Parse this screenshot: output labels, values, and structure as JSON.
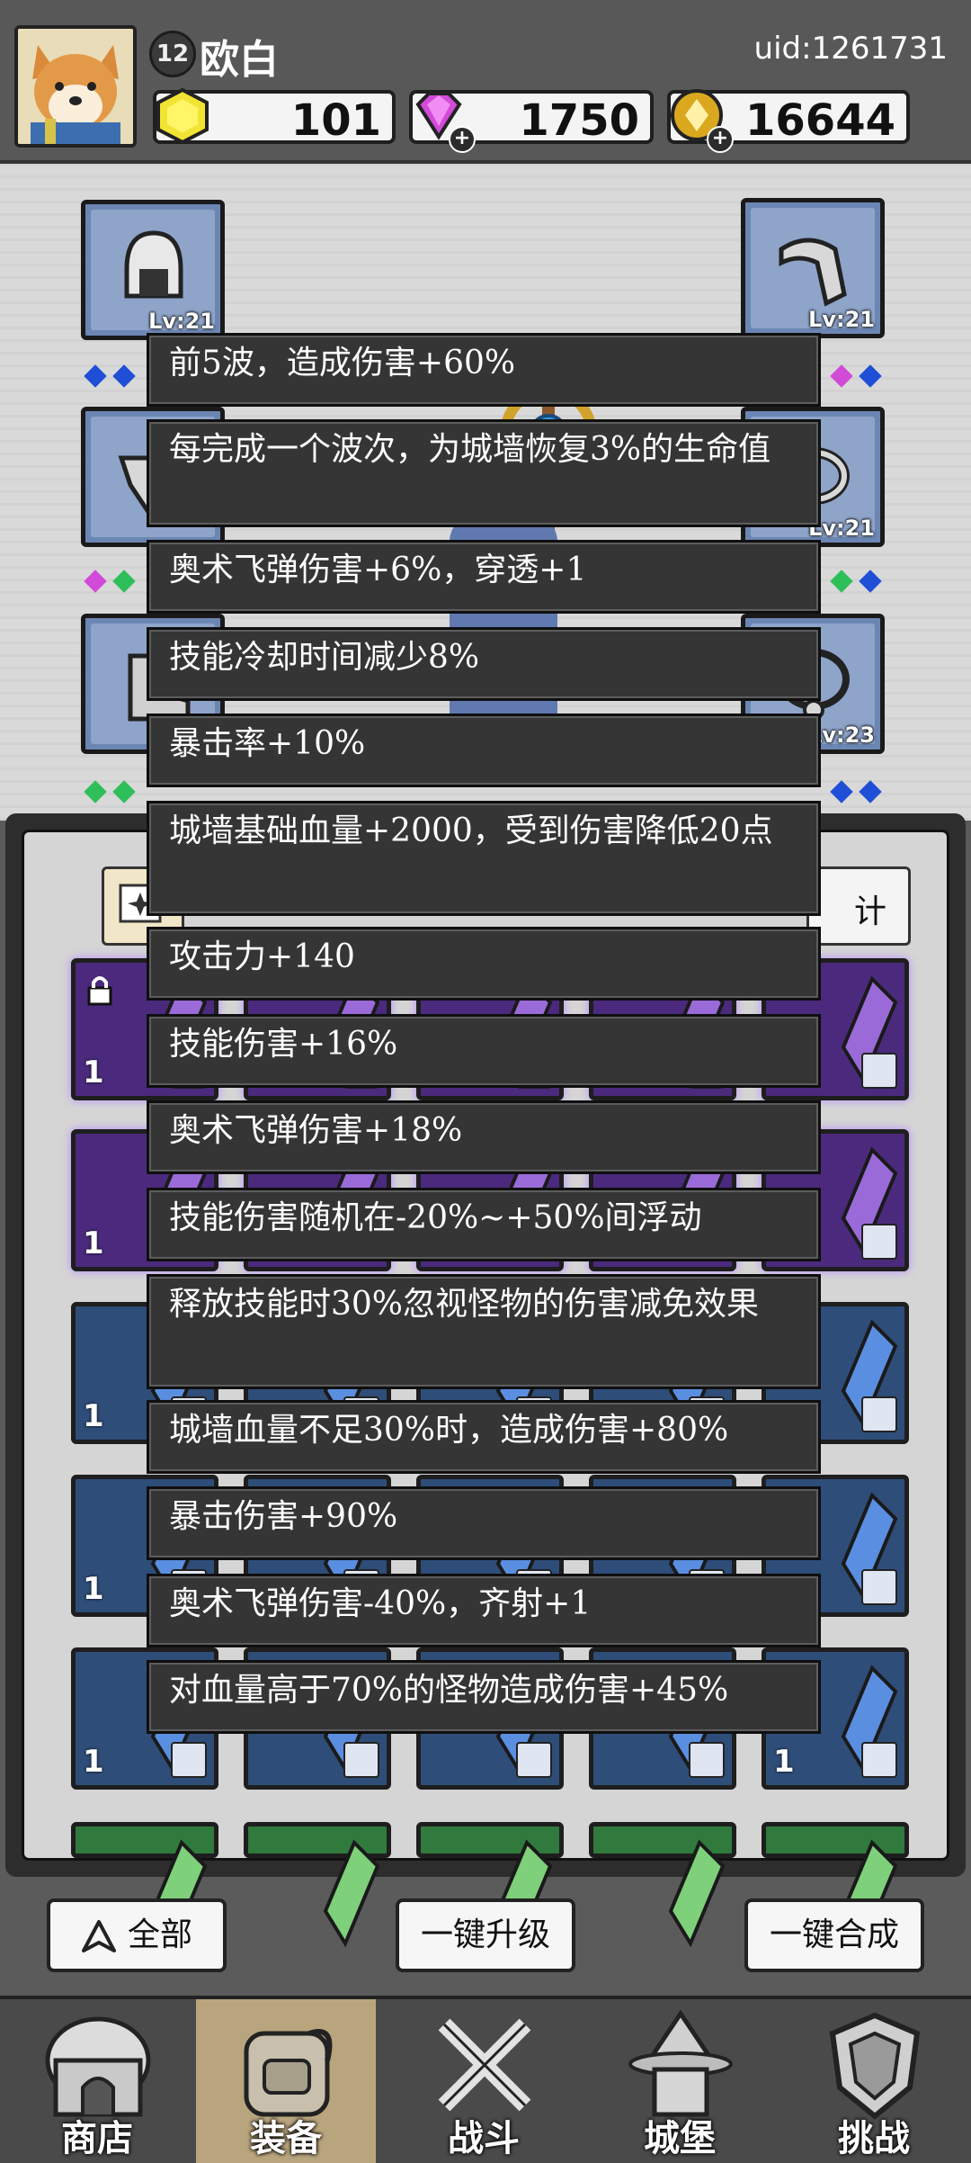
{
  "player": {
    "level": "12",
    "name": "欧白",
    "uid": "uid:1261731"
  },
  "currency": {
    "gold": "101",
    "gems": "1750",
    "coins": "16644"
  },
  "equipment": {
    "slots": [
      {
        "side": "left",
        "level": "Lv:21",
        "icon": "helmet-icon"
      },
      {
        "side": "left",
        "level": "",
        "icon": "scarf-icon"
      },
      {
        "side": "left",
        "level": "",
        "icon": "boots-icon"
      },
      {
        "side": "right",
        "level": "Lv:21",
        "icon": "bracer-icon"
      },
      {
        "side": "right",
        "level": "Lv:21",
        "icon": "ring-icon"
      },
      {
        "side": "right",
        "level": "Lv:23",
        "icon": "necklace-icon"
      }
    ]
  },
  "bag": {
    "stats_label": "计",
    "item_count_label": "1"
  },
  "skills": [
    "前5波，造成伤害+60%",
    "每完成一个波次，为城墙恢复3%的生命值",
    "奥术飞弹伤害+6%，穿透+1",
    "技能冷却时间减少8%",
    "暴击率+10%",
    "城墙基础血量+2000，受到伤害降低20点",
    "攻击力+140",
    "技能伤害+16%",
    "奥术飞弹伤害+18%",
    "技能伤害随机在-20%~+50%间浮动",
    "释放技能时30%忽视怪物的伤害减免效果",
    "城墙血量不足30%时，造成伤害+80%",
    "暴击伤害+90%",
    "奥术飞弹伤害-40%，齐射+1",
    "对血量高于70%的怪物造成伤害+45%"
  ],
  "actions": {
    "filter": "全部",
    "upgrade_all": "一键升级",
    "merge_all": "一键合成"
  },
  "nav": [
    {
      "label": "商店",
      "icon": "shop-icon",
      "active": false
    },
    {
      "label": "装备",
      "icon": "backpack-icon",
      "active": true
    },
    {
      "label": "战斗",
      "icon": "crossed-swords-icon",
      "active": false
    },
    {
      "label": "城堡",
      "icon": "castle-icon",
      "active": false
    },
    {
      "label": "挑战",
      "icon": "shield-icon",
      "active": false
    }
  ],
  "colors": {
    "rarity_purple": "#4b2a7d",
    "rarity_blue": "#2e4d78",
    "rarity_green": "#2f7a3c",
    "gem_blue": "#1f4fd6",
    "gem_pink": "#d24ad8",
    "gem_green": "#2fbf5a"
  }
}
